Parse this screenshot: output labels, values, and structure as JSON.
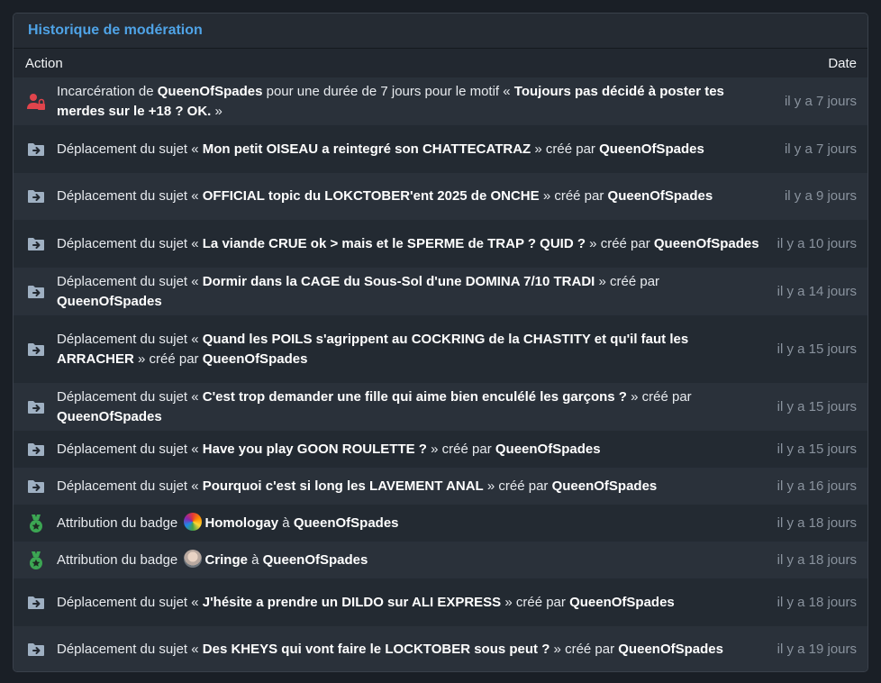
{
  "panel": {
    "title": "Historique de modération"
  },
  "table": {
    "col_action": "Action",
    "col_date": "Date"
  },
  "colors": {
    "title": "#4fa3e6",
    "prison_icon": "#e0444c",
    "folder_icon": "#9fb0c2",
    "badge_icon": "#3ca653"
  },
  "rows": [
    {
      "icon": "prison-user-icon",
      "date": "il y a 7 jours",
      "p1": "Incarcération de ",
      "b1": "QueenOfSpades",
      "p2": " pour une durée de 7 jours pour le motif « ",
      "b2": "Toujours pas décidé à poster tes merdes sur le +18 ? OK.",
      "p3": " »"
    },
    {
      "icon": "folder-move-icon",
      "date": "il y a 7 jours",
      "p1": "Déplacement du sujet « ",
      "b1": "Mon petit OISEAU a reintegré son CHATTECATRAZ",
      "p2": " » créé par ",
      "b2": "QueenOfSpades"
    },
    {
      "icon": "folder-move-icon",
      "date": "il y a 9 jours",
      "p1": "Déplacement du sujet « ",
      "b1": "OFFICIAL topic du LOKCTOBER'ent 2025 de ONCHE",
      "p2": " » créé par ",
      "b2": "QueenOfSpades"
    },
    {
      "icon": "folder-move-icon",
      "date": "il y a 10 jours",
      "p1": "Déplacement du sujet « ",
      "b1": "La viande CRUE ok > mais et le SPERME de TRAP ? QUID ?",
      "p2": " » créé par ",
      "b2": "QueenOfSpades"
    },
    {
      "icon": "folder-move-icon",
      "date": "il y a 14 jours",
      "p1": "Déplacement du sujet « ",
      "b1": "Dormir dans la CAGE du Sous-Sol d'une DOMINA 7/10 TRADI",
      "p2": " » créé par ",
      "b2": "QueenOfSpades"
    },
    {
      "icon": "folder-move-icon",
      "date": "il y a 15 jours",
      "p1": "Déplacement du sujet « ",
      "b1": "Quand les POILS s'agrippent au COCKRING de la CHASTITY et qu'il faut les ARRACHER",
      "p2": " » créé par ",
      "b2": "QueenOfSpades"
    },
    {
      "icon": "folder-move-icon",
      "date": "il y a 15 jours",
      "p1": "Déplacement du sujet « ",
      "b1": "C'est trop demander une fille qui aime bien enculélé les garçons ?",
      "p2": " » créé par ",
      "b2": "QueenOfSpades"
    },
    {
      "icon": "folder-move-icon",
      "date": "il y a 15 jours",
      "p1": "Déplacement du sujet « ",
      "b1": "Have you play GOON ROULETTE ?",
      "p2": " » créé par ",
      "b2": "QueenOfSpades"
    },
    {
      "icon": "folder-move-icon",
      "date": "il y a 16 jours",
      "p1": "Déplacement du sujet « ",
      "b1": "Pourquoi c'est si long les LAVEMENT ANAL",
      "p2": " » créé par ",
      "b2": "QueenOfSpades"
    },
    {
      "icon": "badge-medal-icon",
      "date": "il y a 18 jours",
      "p1": "Attribution du badge ",
      "b1": "Homologay",
      "p2": " à ",
      "b2": "QueenOfSpades",
      "badge_img": "rainbow-badge-icon"
    },
    {
      "icon": "badge-medal-icon",
      "date": "il y a 18 jours",
      "p1": "Attribution du badge ",
      "b1": "Cringe",
      "p2": " à ",
      "b2": "QueenOfSpades",
      "badge_img": "cringe-face-badge-icon"
    },
    {
      "icon": "folder-move-icon",
      "date": "il y a 18 jours",
      "p1": "Déplacement du sujet « ",
      "b1": "J'hésite a prendre un DILDO sur ALI EXPRESS",
      "p2": " » créé par ",
      "b2": "QueenOfSpades"
    },
    {
      "icon": "folder-move-icon",
      "date": "il y a 19 jours",
      "p1": "Déplacement du sujet « ",
      "b1": "Des KHEYS qui vont faire le LOCKTOBER sous peut ?",
      "p2": " » créé par ",
      "b2": "QueenOfSpades"
    }
  ]
}
